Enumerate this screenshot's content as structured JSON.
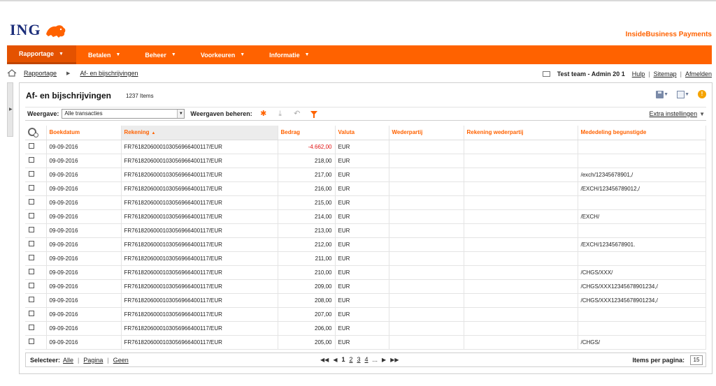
{
  "brand": {
    "logo_text": "ING",
    "product_title": "InsideBusiness Payments",
    "accent": "#ff6200",
    "navy": "#1c2e7a"
  },
  "nav": [
    {
      "label": "Rapportage",
      "active": true
    },
    {
      "label": "Betalen"
    },
    {
      "label": "Beheer"
    },
    {
      "label": "Voorkeuren"
    },
    {
      "label": "Informatie"
    }
  ],
  "breadcrumb": {
    "root": "Rapportage",
    "current": "Af- en bijschrijvingen"
  },
  "user": {
    "name": "Test team - Admin 20 1",
    "help": "Hulp",
    "sitemap": "Sitemap",
    "logout": "Afmelden"
  },
  "page": {
    "title": "Af- en bijschrijvingen",
    "items_count": "1237 Items"
  },
  "viewbar": {
    "view_label": "Weergave:",
    "view_value": "Alle transacties",
    "manage_label": "Weergaven beheren:",
    "extra_settings": "Extra instellingen"
  },
  "columns": [
    "Boekdatum",
    "Rekening",
    "Bedrag",
    "Valuta",
    "Wederpartij",
    "Rekening wederpartij",
    "Mededeling begunstigde"
  ],
  "rows": [
    {
      "date": "09-09-2016",
      "account": "FR7618206000103056966400117/EUR",
      "amount": "-4.662,00",
      "currency": "EUR",
      "note": ""
    },
    {
      "date": "09-09-2016",
      "account": "FR7618206000103056966400117/EUR",
      "amount": "218,00",
      "currency": "EUR",
      "note": ""
    },
    {
      "date": "09-09-2016",
      "account": "FR7618206000103056966400117/EUR",
      "amount": "217,00",
      "currency": "EUR",
      "note": "/exch/12345678901,/"
    },
    {
      "date": "09-09-2016",
      "account": "FR7618206000103056966400117/EUR",
      "amount": "216,00",
      "currency": "EUR",
      "note": "/EXCH/123456789012,/"
    },
    {
      "date": "09-09-2016",
      "account": "FR7618206000103056966400117/EUR",
      "amount": "215,00",
      "currency": "EUR",
      "note": ""
    },
    {
      "date": "09-09-2016",
      "account": "FR7618206000103056966400117/EUR",
      "amount": "214,00",
      "currency": "EUR",
      "note": "/EXCH/"
    },
    {
      "date": "09-09-2016",
      "account": "FR7618206000103056966400117/EUR",
      "amount": "213,00",
      "currency": "EUR",
      "note": ""
    },
    {
      "date": "09-09-2016",
      "account": "FR7618206000103056966400117/EUR",
      "amount": "212,00",
      "currency": "EUR",
      "note": "/EXCH/12345678901."
    },
    {
      "date": "09-09-2016",
      "account": "FR7618206000103056966400117/EUR",
      "amount": "211,00",
      "currency": "EUR",
      "note": ""
    },
    {
      "date": "09-09-2016",
      "account": "FR7618206000103056966400117/EUR",
      "amount": "210,00",
      "currency": "EUR",
      "note": "/CHGS/XXX/"
    },
    {
      "date": "09-09-2016",
      "account": "FR7618206000103056966400117/EUR",
      "amount": "209,00",
      "currency": "EUR",
      "note": "/CHGS/XXX12345678901234,/"
    },
    {
      "date": "09-09-2016",
      "account": "FR7618206000103056966400117/EUR",
      "amount": "208,00",
      "currency": "EUR",
      "note": " /CHGS/XXX12345678901234,/"
    },
    {
      "date": "09-09-2016",
      "account": "FR7618206000103056966400117/EUR",
      "amount": "207,00",
      "currency": "EUR",
      "note": ""
    },
    {
      "date": "09-09-2016",
      "account": "FR7618206000103056966400117/EUR",
      "amount": "206,00",
      "currency": "EUR",
      "note": ""
    },
    {
      "date": "09-09-2016",
      "account": "FR7618206000103056966400117/EUR",
      "amount": "205,00",
      "currency": "EUR",
      "note": "/CHGS/"
    }
  ],
  "footer": {
    "select_label": "Selecteer:",
    "select_all": "Alle",
    "select_page": "Pagina",
    "select_none": "Geen",
    "pages": [
      "1",
      "2",
      "3",
      "4"
    ],
    "ellipsis": "...",
    "items_per_page_label": "Items per pagina:",
    "items_per_page": "15"
  }
}
